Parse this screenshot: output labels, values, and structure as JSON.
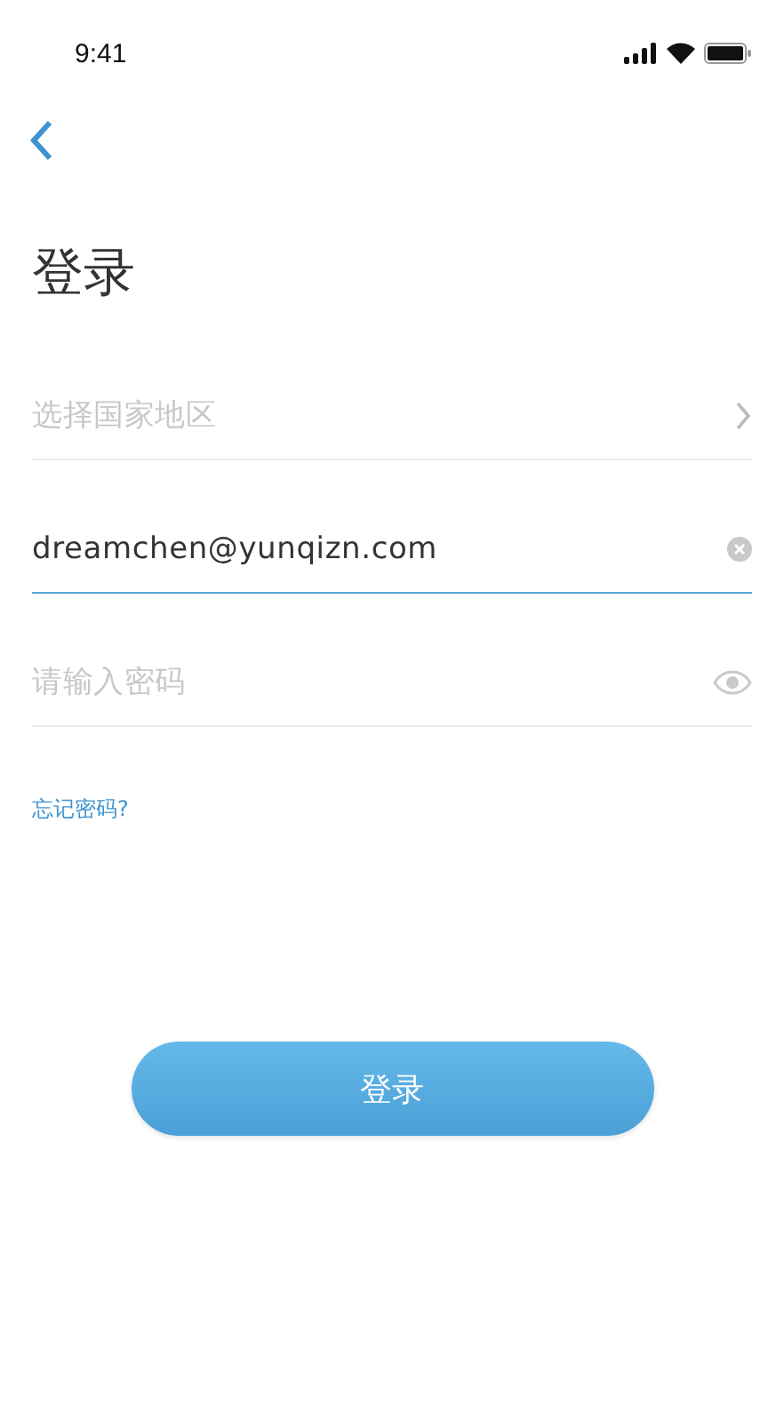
{
  "status_bar": {
    "time": "9:41"
  },
  "title": "登录",
  "fields": [
    {
      "kind": "select",
      "placeholder": "选择国家地区",
      "focused": false
    },
    {
      "kind": "text",
      "value": "dreamchen@yunqizn.com",
      "focused": true
    },
    {
      "kind": "password",
      "placeholder": "请输入密码",
      "focused": false
    }
  ],
  "forgot_link": "忘记密码?",
  "login_button": "登录"
}
